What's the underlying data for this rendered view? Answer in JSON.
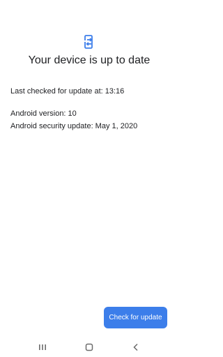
{
  "header": {
    "icon": "system-update-icon",
    "title": "Your device is up to date"
  },
  "info": {
    "last_checked": "Last checked for update at: 13:16",
    "android_version": "Android version: 10",
    "security_update": "Android security update: May 1, 2020"
  },
  "actions": {
    "check_label": "Check for update"
  },
  "navbar": {
    "recents_icon": "recents-icon",
    "home_icon": "home-icon",
    "back_icon": "back-icon"
  },
  "colors": {
    "accent": "#3c7eea",
    "text": "#202124",
    "nav_icon": "#6b6b6b"
  }
}
